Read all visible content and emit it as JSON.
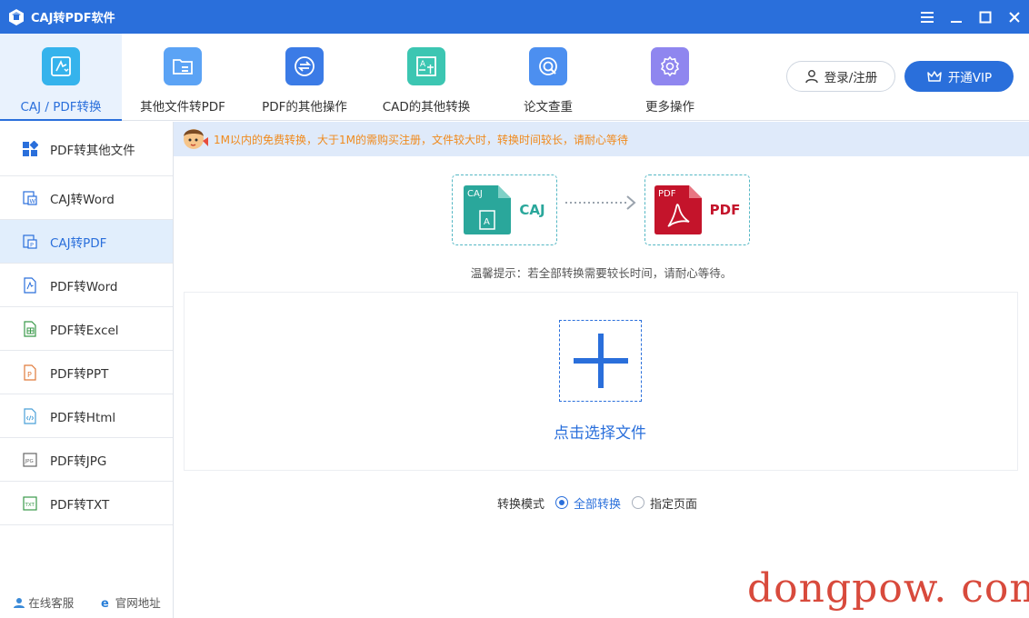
{
  "titlebar": {
    "title": "CAJ转PDF软件"
  },
  "toolbar": {
    "tools": [
      {
        "label": "CAJ / PDF转换",
        "icon": "caj-pdf-convert-icon",
        "color": "#35b3ec",
        "active": true
      },
      {
        "label": "其他文件转PDF",
        "icon": "folder-file-icon",
        "color": "#5ba3f5"
      },
      {
        "label": "PDF的其他操作",
        "icon": "swap-arrows-icon",
        "color": "#3b7be6"
      },
      {
        "label": "CAD的其他转换",
        "icon": "cad-drawing-icon",
        "color": "#3cc6b2"
      },
      {
        "label": "论文查重",
        "icon": "search-check-icon",
        "color": "#4c8ff0"
      },
      {
        "label": "更多操作",
        "icon": "gear-icon",
        "color": "#8f86ef"
      }
    ],
    "login_label": "登录/注册",
    "vip_label": "开通VIP"
  },
  "sidebar": {
    "items": [
      {
        "label": "PDF转其他文件",
        "icon": "grid-icon"
      },
      {
        "label": "CAJ转Word",
        "icon": "caj-word-icon"
      },
      {
        "label": "CAJ转PDF",
        "icon": "caj-pdf-icon",
        "active": true
      },
      {
        "label": "PDF转Word",
        "icon": "pdf-word-icon"
      },
      {
        "label": "PDF转Excel",
        "icon": "pdf-excel-icon"
      },
      {
        "label": "PDF转PPT",
        "icon": "pdf-ppt-icon"
      },
      {
        "label": "PDF转Html",
        "icon": "pdf-html-icon"
      },
      {
        "label": "PDF转JPG",
        "icon": "pdf-jpg-icon"
      },
      {
        "label": "PDF转TXT",
        "icon": "pdf-txt-icon"
      }
    ],
    "footer": {
      "service": "在线客服",
      "website": "官网地址"
    }
  },
  "notice": {
    "text": "1M以内的免费转换，大于1M的需购买注册，文件较大时，转换时间较长，请耐心等待"
  },
  "conversion": {
    "from_tag": "CAJ",
    "from_label": "CAJ",
    "to_tag": "PDF",
    "to_label": "PDF",
    "hint": "温馨提示：若全部转换需要较长时间，请耐心等待。"
  },
  "upload": {
    "choose_label": "点击选择文件"
  },
  "mode": {
    "label": "转换模式",
    "options": [
      "全部转换",
      "指定页面"
    ],
    "selected": "全部转换"
  },
  "watermark": "dongpow. com",
  "colors": {
    "accent": "#2a6fdb",
    "caj_green": "#2aa79b",
    "pdf_red": "#c4142b",
    "notice_orange": "#f08a1c"
  }
}
